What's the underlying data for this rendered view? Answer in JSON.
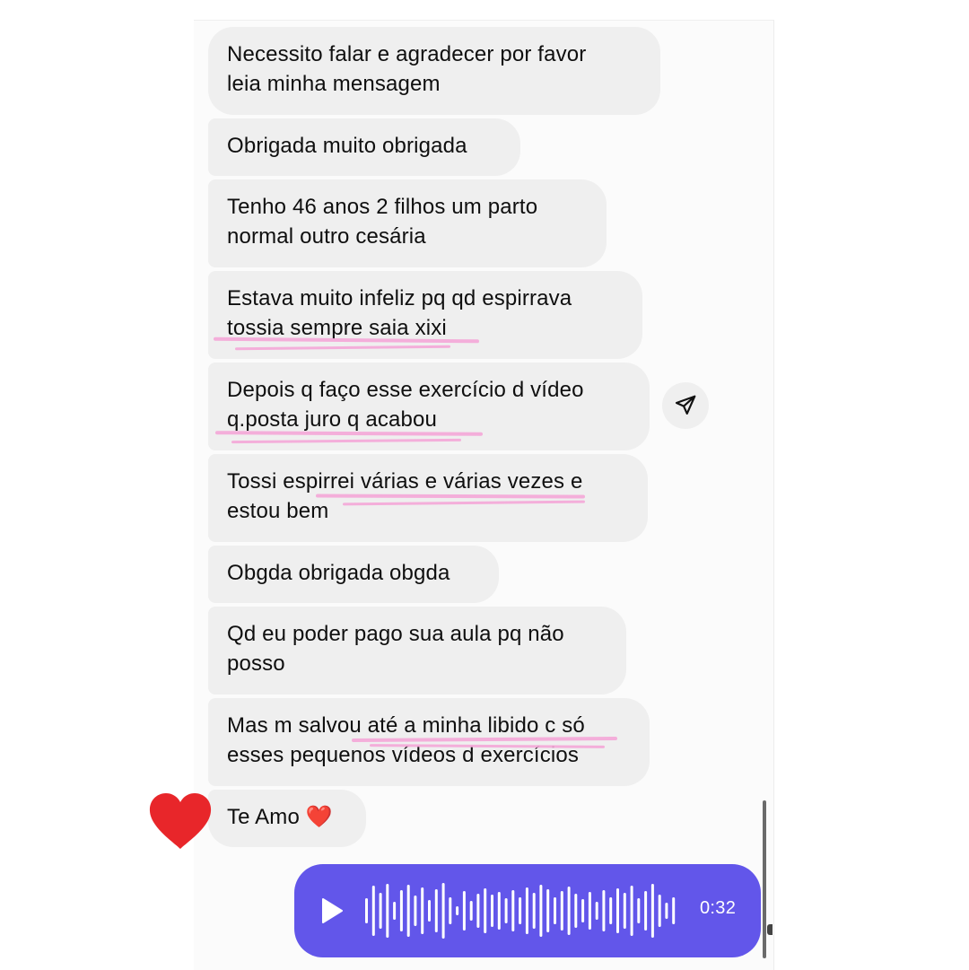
{
  "messages": [
    {
      "text": "Necessito falar e agradecer por favor\nleia minha mensagem"
    },
    {
      "text": "Obrigada muito obrigada"
    },
    {
      "text": "Tenho 46 anos 2 filhos um parto\nnormal outro cesária"
    },
    {
      "text": "Estava muito infeliz pq qd espirrava\ntossia sempre saia xixi"
    },
    {
      "text": "Depois q faço esse exercício d vídeo\nq.posta juro q acabou"
    },
    {
      "text": "Tossi espirrei várias e várias vezes e\nestou bem"
    },
    {
      "text": "Obgda obrigada obgda"
    },
    {
      "text": "Qd eu poder pago sua aula pq não\nposso"
    },
    {
      "text": "Mas m salvou até a minha libido c só\nesses pequenos vídeos d exercícios"
    },
    {
      "text": "Te Amo ❤️"
    }
  ],
  "voice_message": {
    "duration": "0:32"
  },
  "reaction": {
    "icon": "heart-icon",
    "color": "#e8262a"
  },
  "share": {
    "icon": "paper-plane-icon"
  },
  "colors": {
    "incoming_bubble": "#efefef",
    "voice_bubble": "#6256ea",
    "highlight_pink": "#f4a6d7"
  }
}
